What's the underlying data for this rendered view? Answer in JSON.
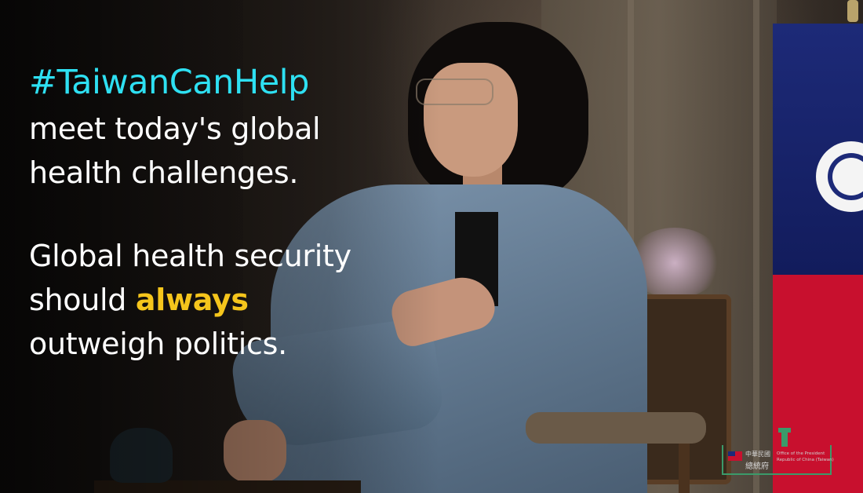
{
  "caption": {
    "hashtag": "#TaiwanCanHelp",
    "line1": "meet today's global",
    "line2": "health challenges.",
    "line3": "Global health security",
    "line4_pre": "should ",
    "line4_highlight": "always",
    "line5": "outweigh politics."
  },
  "logo": {
    "zh_line1": "中華民國",
    "zh_line2": "總統府",
    "en_line1": "Office of the President",
    "en_line2": "Republic of China (Taiwan)"
  },
  "colors": {
    "hashtag": "#2ee0f2",
    "highlight": "#f5c51c",
    "text": "#ffffff",
    "logo_accent": "#3b9a6a"
  }
}
